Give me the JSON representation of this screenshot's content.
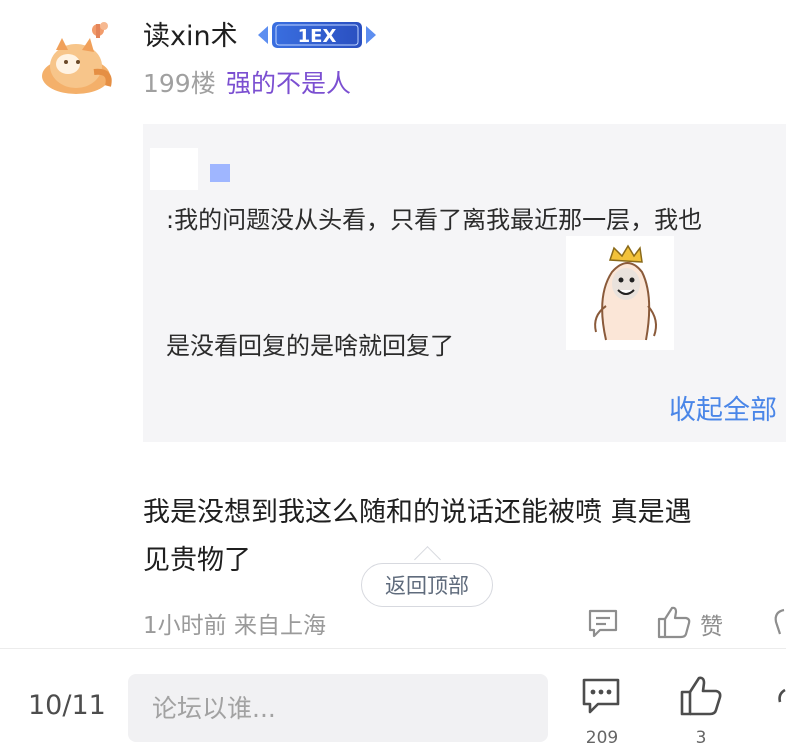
{
  "post": {
    "username": "读xin术",
    "level_badge": "1EX",
    "floor": "199楼",
    "floor_title": "强的不是人"
  },
  "quote": {
    "line1": ":我的问题没从头看，只看了离我最近那一层，我也",
    "line2": "是没看回复的是啥就回复了",
    "collapse_label": "收起全部"
  },
  "reply": {
    "line1": "我是没想到我这么随和的说话还能被喷  真是遇",
    "line2": "见贵物了"
  },
  "back_to_top": "返回顶部",
  "meta": {
    "time_location": "1小时前 来自上海",
    "like_label": "赞"
  },
  "bottom_bar": {
    "page_indicator": "10/11",
    "input_placeholder": "论坛以谁...",
    "comment_count": "209",
    "like_count": "3"
  },
  "colors": {
    "accent_link": "#4a86e8",
    "title_purple": "#7b4fd1",
    "quote_bg": "#f5f5f7"
  }
}
